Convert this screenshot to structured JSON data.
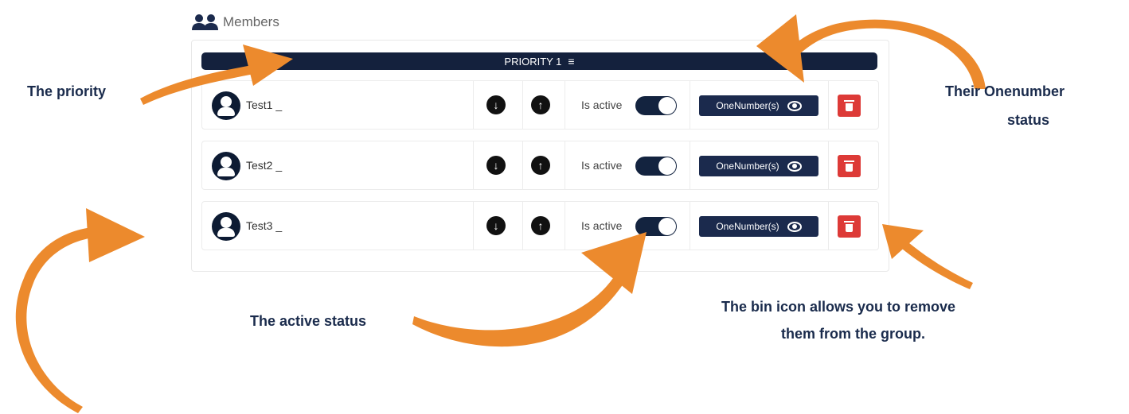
{
  "members_label": "Members",
  "priority_label": "PRIORITY 1",
  "rows": [
    {
      "name": "Test1 _",
      "active_label": "Is active",
      "active": true,
      "onenumber_label": "OneNumber(s)"
    },
    {
      "name": "Test2 _",
      "active_label": "Is active",
      "active": true,
      "onenumber_label": "OneNumber(s)"
    },
    {
      "name": "Test3 _",
      "active_label": "Is active",
      "active": true,
      "onenumber_label": "OneNumber(s)"
    }
  ],
  "annotations": {
    "priority": "The priority",
    "onenumber_line1": "Their Onenumber",
    "onenumber_line2": "status",
    "active": "The active status",
    "bin_line1": "The bin icon allows you to remove",
    "bin_line2": "them from the group."
  },
  "colors": {
    "navy": "#14213d",
    "bin_red": "#dd3a37",
    "arrow_orange": "#ec8a2d"
  },
  "icons": {
    "members": "users-icon",
    "priority": "list-icon",
    "avatar": "user-avatar-icon",
    "move_down": "arrow-down-circle-icon",
    "move_up": "arrow-up-circle-icon",
    "onenumber": "eye-icon",
    "delete": "trash-icon"
  }
}
